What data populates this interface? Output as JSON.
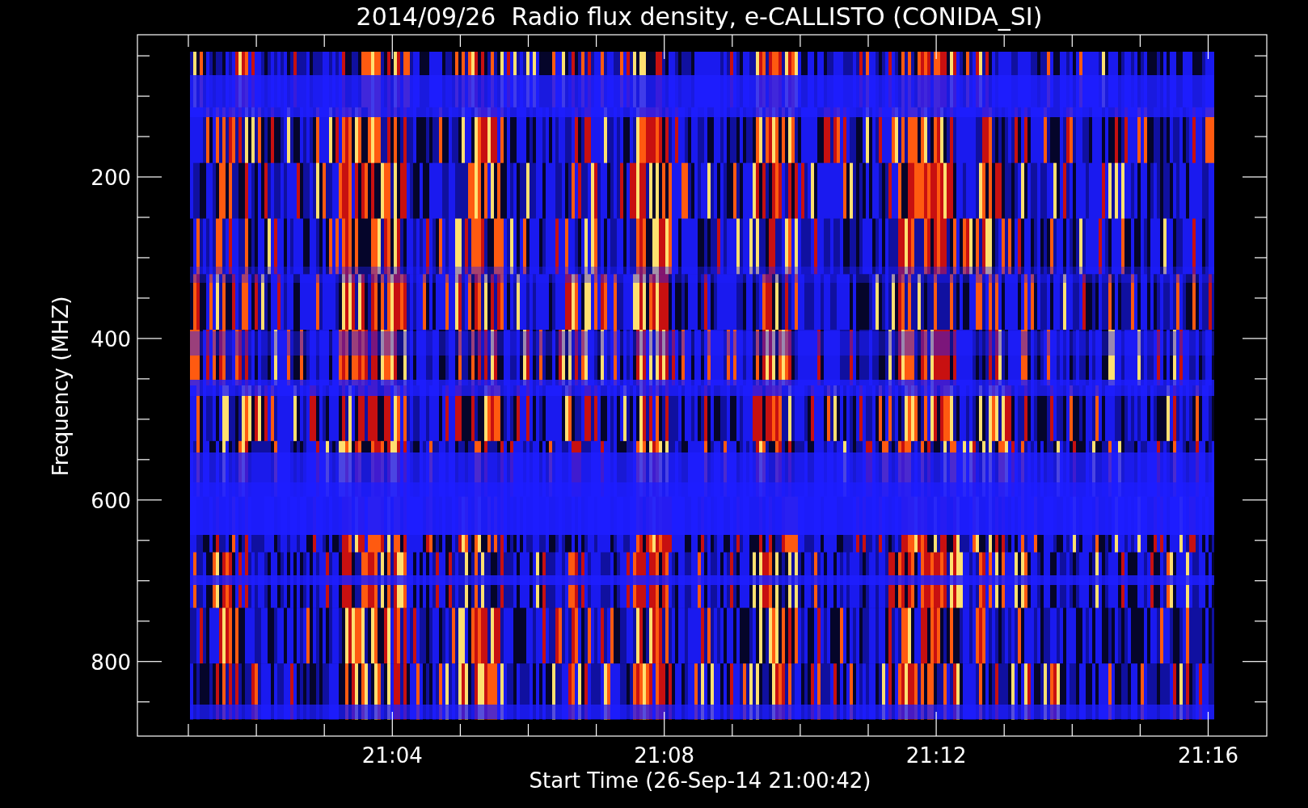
{
  "title": "2014/09/26  Radio flux density, e-CALLISTO (CONIDA_SI)",
  "y_axis": {
    "label": "Frequency (MHZ)",
    "tick_labels": [
      "200",
      "400",
      "600",
      "800"
    ]
  },
  "x_axis": {
    "label": "Start Time (26-Sep-14 21:00:42)",
    "tick_labels": [
      "21:04",
      "21:08",
      "21:12",
      "21:16"
    ]
  }
}
